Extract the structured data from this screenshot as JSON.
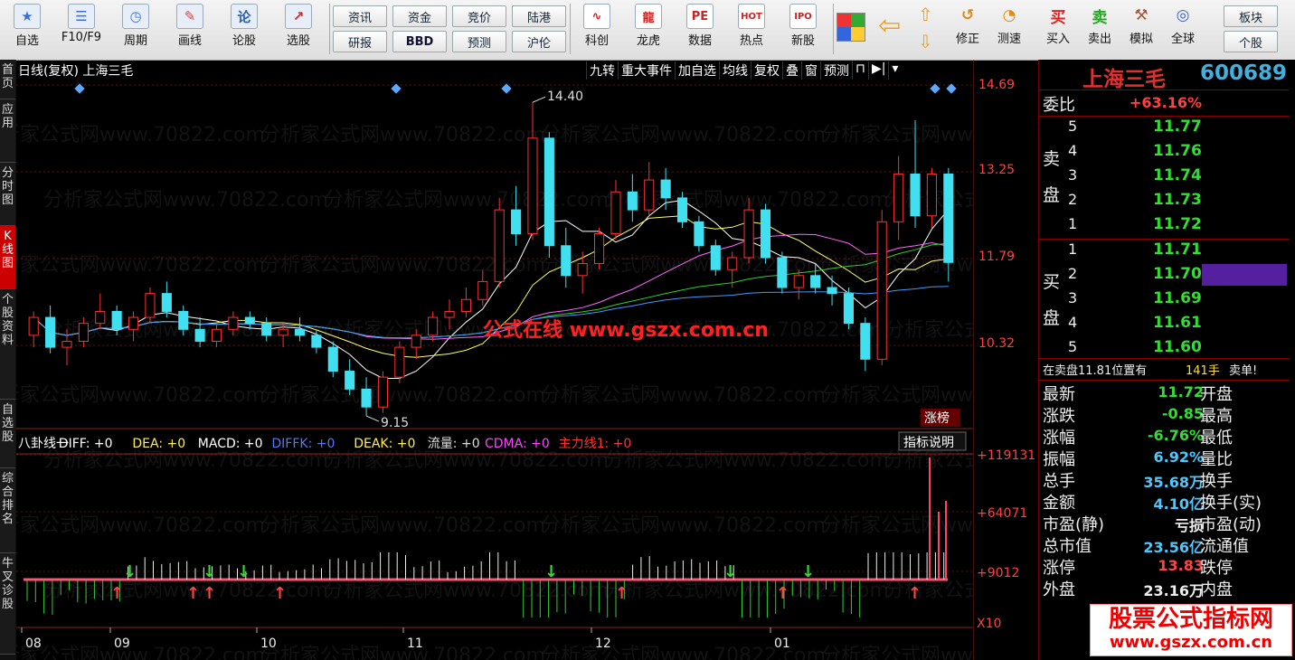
{
  "toolbar": {
    "icons": [
      {
        "label": "自选",
        "icon": "star-icon",
        "glyph": "★"
      },
      {
        "label": "F10/F9",
        "icon": "f10-icon",
        "glyph": "☰"
      },
      {
        "label": "周期",
        "icon": "clock-icon",
        "glyph": "◷"
      },
      {
        "label": "画线",
        "icon": "pen-icon",
        "glyph": "✎"
      },
      {
        "label": "论股",
        "icon": "discuss-icon",
        "glyph": "论"
      },
      {
        "label": "选股",
        "icon": "select-stock-icon",
        "glyph": "↗"
      }
    ],
    "text_buttons": [
      [
        "资讯",
        "研报"
      ],
      [
        "资金",
        "BBD"
      ],
      [
        "竞价",
        "预测"
      ],
      [
        "陆港",
        "沪伦"
      ]
    ],
    "icons2": [
      {
        "label": "科创",
        "icon": "kechuang-icon",
        "glyph": "∿"
      },
      {
        "label": "龙虎",
        "icon": "longhu-icon",
        "glyph": "龍"
      },
      {
        "label": "数据",
        "icon": "data-icon",
        "glyph": "PE"
      },
      {
        "label": "热点",
        "icon": "hot-icon",
        "glyph": "HOT"
      },
      {
        "label": "新股",
        "icon": "ipo-icon",
        "glyph": "IPO"
      }
    ],
    "icons3": [
      {
        "label": "修正",
        "icon": "fix-icon",
        "glyph": "↺"
      },
      {
        "label": "测速",
        "icon": "speed-icon",
        "glyph": "◔"
      },
      {
        "label": "买入",
        "icon": "buy-icon",
        "glyph": "买"
      },
      {
        "label": "卖出",
        "icon": "sell-icon",
        "glyph": "卖"
      },
      {
        "label": "模拟",
        "icon": "simulate-icon",
        "glyph": "⚒"
      },
      {
        "label": "全球",
        "icon": "globe-icon",
        "glyph": "◎"
      }
    ],
    "right_buttons": [
      "板块",
      "个股"
    ]
  },
  "left_tabs": [
    "首页",
    "应用",
    "分时图",
    "K线图",
    "个股资料",
    "自选股",
    "综合排名",
    "牛叉诊股"
  ],
  "chart": {
    "header": "日线(复权) 上海三毛",
    "tabs": [
      "九转",
      "重大事件",
      "加自选",
      "均线",
      "复权",
      "叠",
      "窗",
      "预测"
    ],
    "price_scale": [
      "14.69",
      "13.25",
      "11.79",
      "10.32"
    ],
    "high_label": "14.40",
    "low_label": "9.15",
    "overlay": "公式在线  www.gszx.com.cn",
    "limit_tag": "涨榜",
    "indicator_line": [
      {
        "text": "八卦线一",
        "color": "#ffffff"
      },
      {
        "text": "DIFF: +0",
        "color": "#ffffff"
      },
      {
        "text": "DEA: +0",
        "color": "#ffee55"
      },
      {
        "text": "MACD: +0",
        "color": "#ffffff"
      },
      {
        "text": "DIFFK: +0",
        "color": "#5577ff"
      },
      {
        "text": "DEAK: +0",
        "color": "#ffee55"
      },
      {
        "text": "流量: +0",
        "color": "#dddddd"
      },
      {
        "text": "CDMA: +0",
        "color": "#ff44ff"
      },
      {
        "text": "主力线1: +0",
        "color": "#ff3333"
      }
    ],
    "indicator_button": "指标说明",
    "indicator_scale": [
      "+119131",
      "+64071",
      "+9012",
      "X10"
    ],
    "months": [
      "08",
      "09",
      "10",
      "11",
      "12",
      "01"
    ],
    "watermark": "分析家公式网www.70822.com"
  },
  "chart_data": {
    "type": "candlestick",
    "stock": "上海三毛",
    "ylim": [
      9.0,
      14.69
    ],
    "x": [
      "08",
      "09",
      "10",
      "11",
      "12",
      "01"
    ],
    "candles": [
      [
        10.5,
        10.9,
        10.3,
        10.8
      ],
      [
        10.8,
        11.0,
        10.2,
        10.3
      ],
      [
        10.3,
        10.6,
        10.0,
        10.4
      ],
      [
        10.4,
        10.8,
        10.3,
        10.7
      ],
      [
        10.7,
        11.2,
        10.6,
        10.9
      ],
      [
        10.9,
        11.0,
        10.5,
        10.6
      ],
      [
        10.6,
        10.9,
        10.4,
        10.8
      ],
      [
        10.8,
        11.3,
        10.7,
        11.2
      ],
      [
        11.2,
        11.4,
        10.8,
        10.9
      ],
      [
        10.9,
        11.0,
        10.5,
        10.6
      ],
      [
        10.6,
        10.8,
        10.3,
        10.4
      ],
      [
        10.4,
        10.7,
        10.3,
        10.6
      ],
      [
        10.6,
        10.9,
        10.5,
        10.8
      ],
      [
        10.8,
        10.9,
        10.6,
        10.7
      ],
      [
        10.7,
        10.8,
        10.4,
        10.5
      ],
      [
        10.5,
        10.7,
        10.3,
        10.6
      ],
      [
        10.6,
        10.8,
        10.4,
        10.5
      ],
      [
        10.5,
        10.6,
        10.2,
        10.3
      ],
      [
        10.3,
        10.4,
        9.8,
        9.9
      ],
      [
        9.9,
        10.1,
        9.5,
        9.6
      ],
      [
        9.6,
        9.8,
        9.15,
        9.3
      ],
      [
        9.3,
        9.9,
        9.2,
        9.8
      ],
      [
        9.8,
        10.4,
        9.7,
        10.3
      ],
      [
        10.3,
        10.6,
        10.1,
        10.5
      ],
      [
        10.5,
        10.9,
        10.4,
        10.8
      ],
      [
        10.8,
        11.1,
        10.6,
        10.9
      ],
      [
        10.9,
        11.3,
        10.8,
        11.1
      ],
      [
        11.1,
        11.6,
        11.0,
        11.4
      ],
      [
        11.4,
        12.8,
        11.3,
        12.6
      ],
      [
        12.6,
        13.0,
        12.0,
        12.2
      ],
      [
        12.2,
        14.4,
        12.1,
        13.8
      ],
      [
        13.8,
        13.9,
        11.8,
        12.0
      ],
      [
        12.0,
        12.3,
        11.3,
        11.5
      ],
      [
        11.5,
        11.9,
        11.2,
        11.7
      ],
      [
        11.7,
        12.3,
        11.6,
        12.2
      ],
      [
        12.2,
        13.1,
        12.1,
        12.9
      ],
      [
        12.9,
        13.2,
        12.4,
        12.6
      ],
      [
        12.6,
        13.4,
        12.5,
        13.1
      ],
      [
        13.1,
        13.3,
        12.6,
        12.8
      ],
      [
        12.8,
        12.9,
        12.3,
        12.4
      ],
      [
        12.4,
        12.5,
        11.9,
        12.0
      ],
      [
        12.0,
        12.1,
        11.5,
        11.6
      ],
      [
        11.6,
        11.9,
        11.3,
        11.8
      ],
      [
        11.8,
        12.8,
        11.7,
        12.6
      ],
      [
        12.6,
        12.7,
        11.7,
        11.8
      ],
      [
        11.8,
        11.9,
        11.2,
        11.3
      ],
      [
        11.3,
        11.6,
        11.1,
        11.5
      ],
      [
        11.5,
        11.7,
        11.2,
        11.3
      ],
      [
        11.3,
        11.5,
        11.0,
        11.2
      ],
      [
        11.2,
        11.3,
        10.6,
        10.7
      ],
      [
        10.7,
        10.8,
        9.9,
        10.1
      ],
      [
        10.1,
        12.6,
        10.0,
        12.4
      ],
      [
        12.4,
        13.5,
        12.1,
        13.2
      ],
      [
        13.2,
        14.1,
        12.3,
        12.5
      ],
      [
        12.5,
        13.3,
        12.3,
        13.2
      ],
      [
        13.2,
        13.3,
        11.4,
        11.72
      ]
    ],
    "volume_series_name": "流量"
  },
  "quote": {
    "name": "上海三毛",
    "code": "600689",
    "weibi_label": "委比",
    "weibi": "+63.16%",
    "sell_label": "卖盘",
    "buy_label": "买盘",
    "sell": [
      [
        "5",
        "11.77"
      ],
      [
        "4",
        "11.76"
      ],
      [
        "3",
        "11.74"
      ],
      [
        "2",
        "11.73"
      ],
      [
        "1",
        "11.72"
      ]
    ],
    "buy": [
      [
        "1",
        "11.71"
      ],
      [
        "2",
        "11.70"
      ],
      [
        "3",
        "11.69"
      ],
      [
        "4",
        "11.61"
      ],
      [
        "5",
        "11.60"
      ]
    ],
    "notice": "在卖盘11.81位置有",
    "notice_qty": "141手",
    "notice_tail": "卖单!",
    "stats": [
      [
        "最新",
        "11.72",
        "开盘"
      ],
      [
        "涨跌",
        "-0.85",
        "最高"
      ],
      [
        "涨幅",
        "-6.76%",
        "最低"
      ],
      [
        "振幅",
        "6.92%",
        "量比"
      ],
      [
        "总手",
        "35.68万",
        "换手"
      ],
      [
        "金额",
        "4.10亿",
        "换手(实)"
      ],
      [
        "市盈(静)",
        "亏损",
        "市盈(动)"
      ],
      [
        "总市值",
        "23.56亿",
        "流通值"
      ],
      [
        "涨停",
        "13.83",
        "跌停"
      ],
      [
        "外盘",
        "23.16万",
        "内盘"
      ]
    ]
  },
  "promo": {
    "title": "股票公式指标网",
    "url": "www.gszx.com.cn"
  },
  "colors": {
    "up": "#ff3030",
    "down": "#40e0f0",
    "ma5": "#ffffff",
    "ma10": "#ffff66",
    "ma20": "#ff66ff",
    "ma30": "#33cc33",
    "ma60": "#4499ff"
  }
}
